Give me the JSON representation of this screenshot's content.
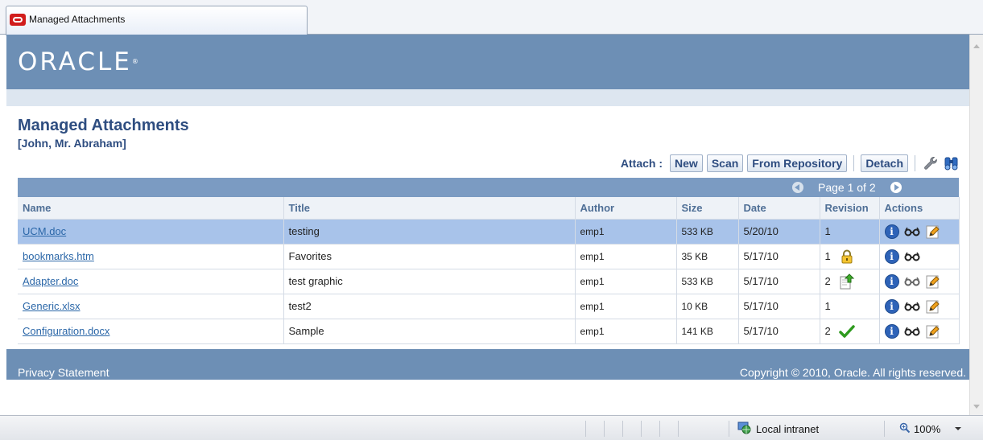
{
  "browser": {
    "tab_title": "Managed Attachments"
  },
  "brand": {
    "logo_text": "ORACLE",
    "logo_mark": "®"
  },
  "page": {
    "title": "Managed Attachments",
    "subtitle": "[John, Mr. Abraham]"
  },
  "toolbar": {
    "attach_label": "Attach :",
    "new_label": "New",
    "scan_label": "Scan",
    "from_repository_label": "From Repository",
    "detach_label": "Detach",
    "icons": [
      "wrench-icon",
      "binoculars-search-icon"
    ]
  },
  "pager": {
    "text": "Page 1 of 2"
  },
  "table": {
    "columns": [
      "Name",
      "Title",
      "Author",
      "Size",
      "Date",
      "Revision",
      "Actions"
    ],
    "rows": [
      {
        "name": "UCM.doc",
        "title": "testing",
        "author": "emp1",
        "size": "533 KB",
        "date": "5/20/10",
        "revision": "1",
        "status_icon": "",
        "selected": true,
        "actions": [
          "info-icon",
          "view-glasses-icon",
          "edit-pencil-icon"
        ]
      },
      {
        "name": "bookmarks.htm",
        "title": "Favorites",
        "author": "emp1",
        "size": "35 KB",
        "date": "5/17/10",
        "revision": "1",
        "status_icon": "lock-icon",
        "selected": false,
        "actions": [
          "info-icon",
          "view-glasses-icon"
        ]
      },
      {
        "name": "Adapter.doc",
        "title": "test graphic",
        "author": "emp1",
        "size": "533 KB",
        "date": "5/17/10",
        "revision": "2",
        "status_icon": "checkout-document-icon",
        "selected": false,
        "actions": [
          "info-icon",
          "view-glasses-icon",
          "edit-pencil-icon"
        ]
      },
      {
        "name": "Generic.xlsx",
        "title": "test2",
        "author": "emp1",
        "size": "10 KB",
        "date": "5/17/10",
        "revision": "1",
        "status_icon": "",
        "selected": false,
        "actions": [
          "info-icon",
          "view-glasses-icon",
          "edit-pencil-icon"
        ]
      },
      {
        "name": "Configuration.docx",
        "title": "Sample",
        "author": "emp1",
        "size": "141 KB",
        "date": "5/17/10",
        "revision": "2",
        "status_icon": "checkmark-icon",
        "selected": false,
        "actions": [
          "info-icon",
          "view-glasses-icon",
          "edit-pencil-icon"
        ]
      }
    ]
  },
  "footer": {
    "privacy_label": "Privacy Statement",
    "copyright": "Copyright © 2010, Oracle. All rights reserved."
  },
  "statusbar": {
    "zone": "Local intranet",
    "zoom": "100%"
  },
  "colors": {
    "brand_blue": "#6d8fb5",
    "title_blue": "#2e4d80",
    "selected_row": "#a8c3ea",
    "link_blue": "#2b67a8",
    "accent_red": "#d11c1c"
  }
}
